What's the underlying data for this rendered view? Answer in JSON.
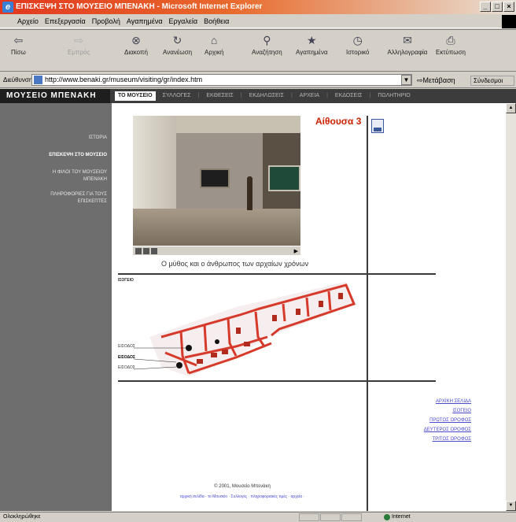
{
  "window": {
    "title": "ΕΠΙΣΚΕΨΗ ΣΤΟ ΜΟΥΣΕΙΟ ΜΠΕΝΑΚΗ - Microsoft Internet Explorer",
    "buttons": [
      "_",
      "□",
      "×"
    ]
  },
  "menu": [
    "Αρχείο",
    "Επεξεργασία",
    "Προβολή",
    "Αγαπημένα",
    "Εργαλεία",
    "Βοήθεια"
  ],
  "toolbar": [
    {
      "label": "Πίσω",
      "icon": "back-icon"
    },
    {
      "label": "Εμπρός",
      "icon": "forward-icon",
      "disabled": true
    },
    {
      "label": "Διακοπή",
      "icon": "stop-icon"
    },
    {
      "label": "Ανανέωση",
      "icon": "refresh-icon"
    },
    {
      "label": "Αρχική",
      "icon": "home-icon"
    },
    {
      "label": "Αναζήτηση",
      "icon": "search-icon"
    },
    {
      "label": "Αγαπημένα",
      "icon": "favorites-icon"
    },
    {
      "label": "Ιστορικό",
      "icon": "history-icon"
    },
    {
      "label": "Αλληλογραφία",
      "icon": "mail-icon"
    },
    {
      "label": "Εκτύπωση",
      "icon": "print-icon"
    }
  ],
  "address": {
    "label": "Διεύθυνση",
    "url": "http://www.benaki.gr/museum/visiting/gr/index.htm",
    "go": "Μετάβαση",
    "links": "Σύνδεσμοι"
  },
  "site": {
    "brand": "ΜΟΥΣΕΙΟ ΜΠΕΝΑΚΗ",
    "nav": [
      "ΤΟ ΜΟΥΣΕΙΟ",
      "ΣΥΛΛΟΓΕΣ",
      "ΕΚΘΕΣΕΙΣ",
      "ΕΚΔΗΛΩΣΕΙΣ",
      "ΑΡΧΕΙΑ",
      "ΕΚΔΟΣΕΙΣ",
      "ΠΩΛΗΤΗΡΙΟ"
    ],
    "sidebar": [
      "ΙΣΤΟΡΙΑ",
      "ΕΠΙΣΚΕΨΗ ΣΤΟ ΜΟΥΣΕΙΟ",
      "Η ΦΙΛΟΙ ΤΟΥ ΜΟΥΣΕΙΟΥ ΜΠΕΝΑΚΗ",
      "ΠΛΗΡΟΦΟΡΙΕΣ ΓΙΑ ΤΟΥΣ ΕΠΙΣΚΕΠΤΕΣ"
    ]
  },
  "page": {
    "room_title": "Αίθουσα 3",
    "caption": "Ο μύθος και ο άνθρωπος των αρχαίων χρόνων",
    "floor_label": "ΙΣΟΓΕΙΟ",
    "plan_labels": [
      "ΕΙΣΟΔΟΣ",
      "ΕΙΣΟΔΟΣ",
      "ΕΙΣΟΔΟΣ"
    ],
    "links": [
      "ΑΡΧΙΚΗ ΣΕΛΙΔΑ",
      "ΙΣΟΓΕΙΟ",
      "ΠΡΩΤΟΣ ΟΡΟΦΟΣ",
      "ΔΕΥΤΕΡΟΣ ΟΡΟΦΟΣ",
      "ΤΡΙΤΟΣ ΟΡΟΦΟΣ"
    ],
    "copyright": "© 2001, Μουσείο Μπενάκη",
    "footer_links": [
      "αρχική σελίδα",
      "το Μουσείο",
      "Συλλογές",
      "πληροφοριακές τιμές",
      "αρχεία"
    ]
  },
  "status": {
    "text": "Ολοκληρώθηκε",
    "zone": "Internet"
  },
  "colors": {
    "title_start": "#e2381e",
    "sidebar": "#6e6e6e",
    "room_title": "#cc2200",
    "plan": "#d63a2a",
    "link": "#4a4ad0"
  }
}
